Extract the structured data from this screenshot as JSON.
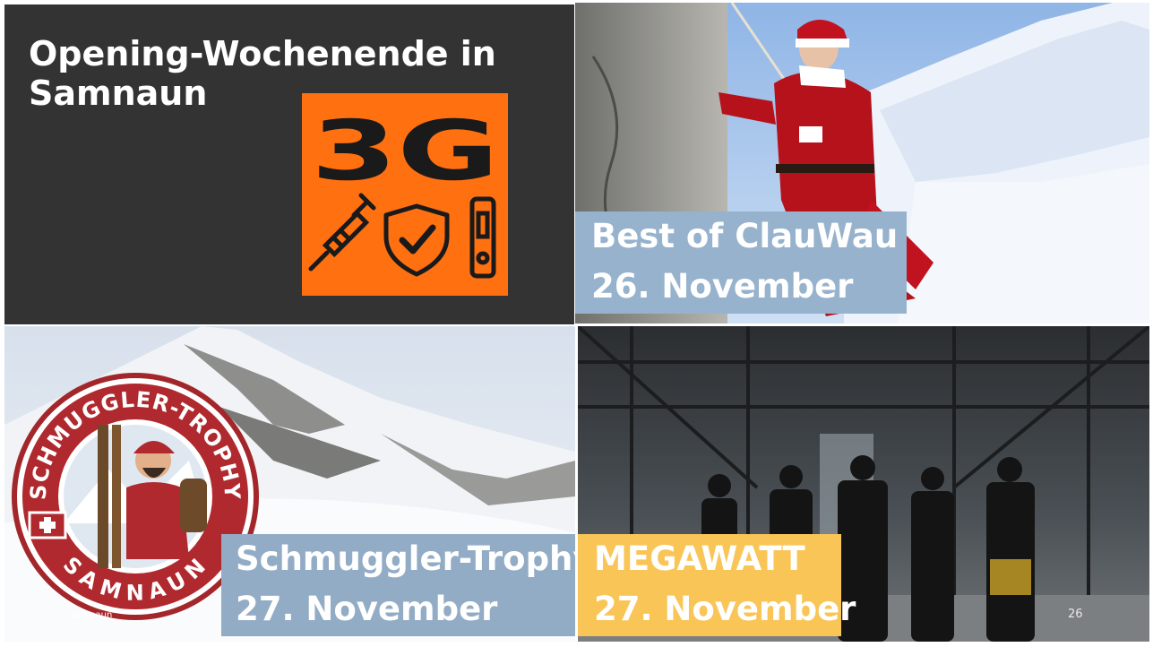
{
  "slide": {
    "title_line1": "Opening-Wochenende in",
    "title_line2": "Samnaun",
    "badge_text": "3G",
    "colors": {
      "dark_panel": "#333333",
      "badge_orange": "#ff7011",
      "caption_blue": "#97b2cd",
      "caption_yellow": "#f9c557"
    },
    "badge_icons": [
      "syringe-icon",
      "shield-check-icon",
      "test-kit-icon"
    ]
  },
  "events": [
    {
      "title": "Best of ClauWau",
      "date": "26. November"
    },
    {
      "title": "Schmuggler-Trophy",
      "date": "27. November"
    },
    {
      "title": "MEGAWATT",
      "date": "27. November"
    }
  ],
  "logo": {
    "top_text": "SCHMUGGLER-TROPHY",
    "bottom_text": "SAMNAUN"
  },
  "footer": {
    "left": "Samnaun",
    "page_number": "26"
  }
}
